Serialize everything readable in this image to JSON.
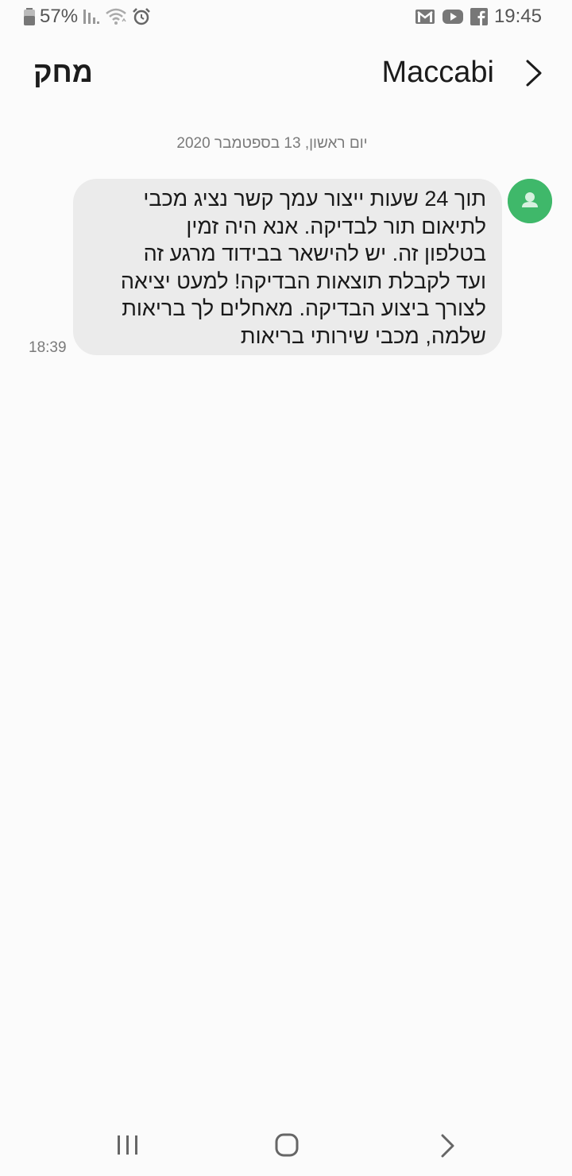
{
  "status_bar": {
    "battery": "57%",
    "time": "19:45",
    "icons": [
      "battery-icon",
      "signal-icon",
      "wifi-icon",
      "alarm-icon",
      "gmail-icon",
      "youtube-icon",
      "facebook-icon"
    ]
  },
  "header": {
    "delete_label": "מחק",
    "contact_name": "Maccabi",
    "back_icon": "chevron-right-icon"
  },
  "conversation": {
    "date": "יום ראשון, 13 בספטמבר 2020",
    "messages": [
      {
        "text": "תוך 24 שעות ייצור עמך קשר נציג מכבי\nלתיאום תור לבדיקה.  אנא היה זמין\nבטלפון זה. יש להישאר בבידוד מרגע זה\nועד לקבלת תוצאות הבדיקה! למעט יציאה\nלצורך ביצוע הבדיקה.  מאחלים לך בריאות\nשלמה, מכבי שירותי בריאות",
        "time": "18:39"
      }
    ]
  },
  "colors": {
    "avatar": "#3fb86a",
    "bubble": "#ebebeb",
    "background": "#fbfbfb"
  },
  "nav_bar": {
    "icons": [
      "recent-apps-icon",
      "home-icon",
      "back-icon"
    ]
  }
}
